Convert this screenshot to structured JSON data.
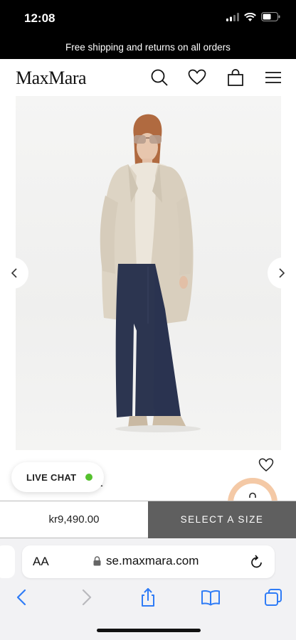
{
  "status_bar": {
    "time": "12:08"
  },
  "promo": {
    "text": "Free shipping and returns on all orders"
  },
  "header": {
    "logo": "MaxMara",
    "icons": [
      "search-icon",
      "heart-icon",
      "shopping-bag-icon",
      "menu-icon"
    ]
  },
  "product": {
    "price": "kr9,490.00",
    "select_size_label": "SELECT A SIZE",
    "partial_title": "t"
  },
  "chat": {
    "label": "LIVE CHAT",
    "status_color": "#55c12e"
  },
  "browser": {
    "text_size_label": "AA",
    "url": "se.maxmara.com"
  },
  "colors": {
    "accent_button": "#5f5f5f",
    "promo_background": "#000000"
  }
}
